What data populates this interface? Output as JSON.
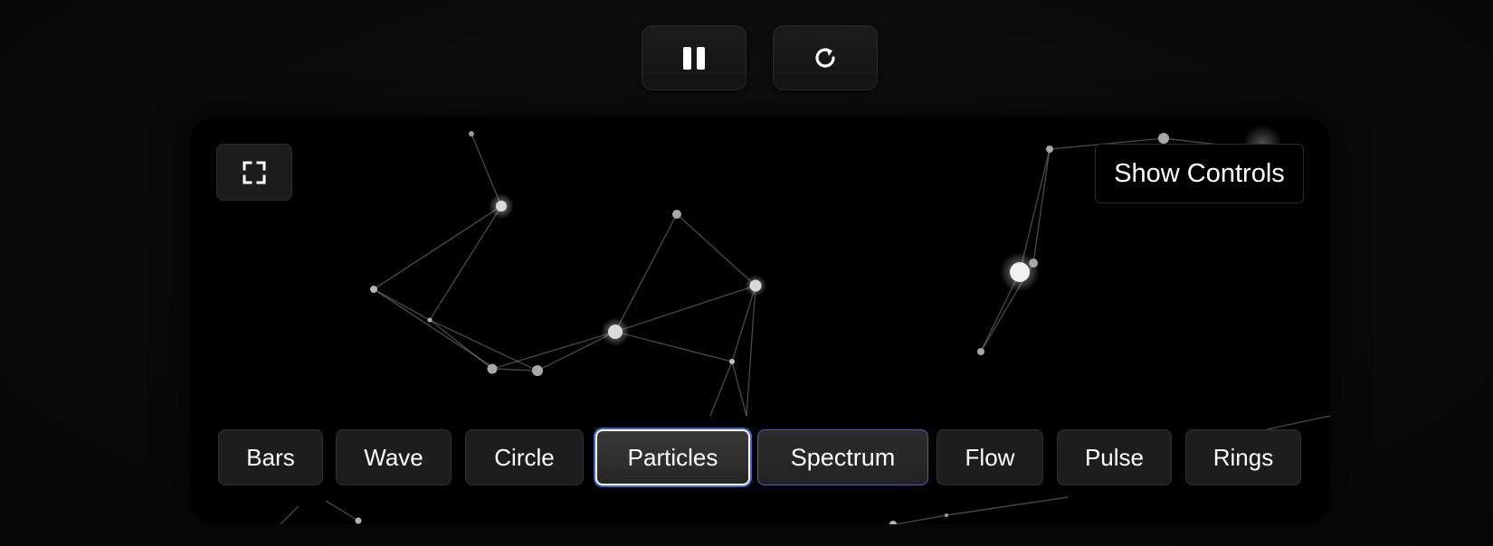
{
  "toolbar": {
    "pause_icon": "pause-icon",
    "restart_icon": "restart-icon"
  },
  "stage": {
    "fullscreen_icon": "fullscreen-icon",
    "show_controls_label": "Show Controls",
    "active_mode": "Particles"
  },
  "modes": [
    {
      "label": "Bars"
    },
    {
      "label": "Wave"
    },
    {
      "label": "Circle"
    },
    {
      "label": "Particles"
    },
    {
      "label": "Spectrum"
    },
    {
      "label": "Flow"
    },
    {
      "label": "Pulse"
    },
    {
      "label": "Rings"
    }
  ],
  "colors": {
    "background": "#0b0b0b",
    "stage": "#000000",
    "active_border": "#ffffff",
    "active_glow": "#3a66d8",
    "hover_border": "#4b58c8",
    "particle": "#e6e6e6"
  }
}
